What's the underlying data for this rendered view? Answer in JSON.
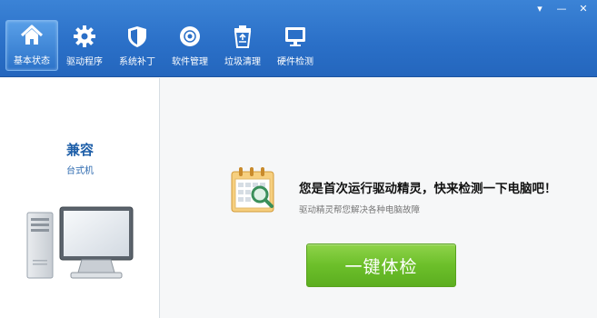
{
  "toolbar": {
    "window_controls": [
      {
        "icon": "dropdown-icon",
        "glyph": "▾"
      },
      {
        "icon": "minimize-icon",
        "glyph": "—"
      },
      {
        "icon": "close-icon",
        "glyph": "✕"
      }
    ],
    "tabs": [
      {
        "label": "基本状态",
        "icon": "home-icon",
        "active": true
      },
      {
        "label": "驱动程序",
        "icon": "gear-icon",
        "active": false
      },
      {
        "label": "系统补丁",
        "icon": "shield-icon",
        "active": false
      },
      {
        "label": "软件管理",
        "icon": "disc-icon",
        "active": false
      },
      {
        "label": "垃圾清理",
        "icon": "recycle-bin-icon",
        "active": false
      },
      {
        "label": "硬件检测",
        "icon": "monitor-icon",
        "active": false
      }
    ]
  },
  "left_panel": {
    "computer_name": "兼容",
    "computer_type": "台式机"
  },
  "main": {
    "headline": "您是首次运行驱动精灵，快来检测一下电脑吧！",
    "subline": "驱动精灵帮您解决各种电脑故障",
    "check_button": "一键体检"
  },
  "colors": {
    "toolbar_blue": "#2a6fc7",
    "accent_green": "#6cbf2a",
    "title_blue": "#1d5ea8"
  }
}
